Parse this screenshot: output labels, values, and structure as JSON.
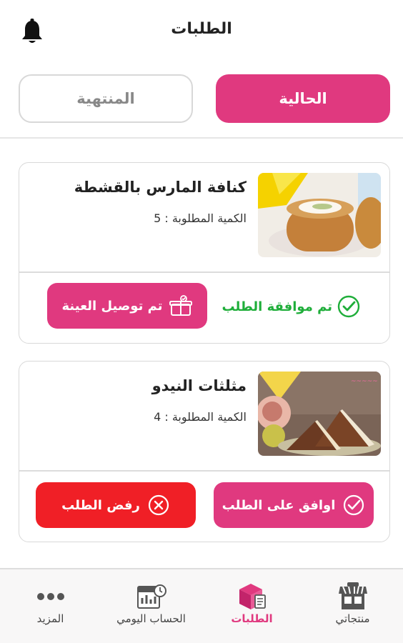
{
  "header": {
    "title": "الطلبات",
    "bell_icon": "bell-icon"
  },
  "tabs": {
    "current_label": "الحالية",
    "finished_label": "المنتهية"
  },
  "colors": {
    "accent": "#e0397f",
    "danger": "#f01f26",
    "success": "#1fae3a"
  },
  "orders": [
    {
      "name": "كنافة المارس بالقشطة",
      "quantity_text": "الكمية المطلوبة : 5",
      "status_text": "تم موافقة الطلب",
      "action_label": "تم توصيل العينة"
    },
    {
      "name": "مثلثات النيدو",
      "quantity_text": "الكمية المطلوبة : 4",
      "accept_label": "اوافق على الطلب",
      "reject_label": "رفض الطلب"
    }
  ],
  "bottom_nav": {
    "items": [
      {
        "label": "منتجاتي",
        "icon": "store-icon"
      },
      {
        "label": "الطلبات",
        "icon": "orders-box-icon"
      },
      {
        "label": "الحساب اليومي",
        "icon": "daily-account-icon"
      },
      {
        "label": "المزيد",
        "icon": "more-dots-icon"
      }
    ]
  }
}
